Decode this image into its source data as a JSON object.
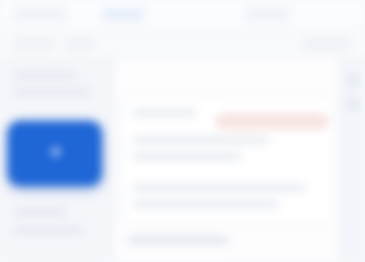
{
  "header": {
    "tabs": [
      {
        "label": ""
      },
      {
        "label": ""
      },
      {
        "label": ""
      }
    ]
  },
  "app_tile": {
    "icon": "app-icon",
    "color": "#1f66d6"
  },
  "main": {
    "pill_label": "",
    "lines": [
      "",
      "",
      "",
      "",
      ""
    ]
  },
  "colors": {
    "accent": "#1f66d6",
    "pill": "#f7e4e1",
    "background": "#f7f9fc"
  }
}
